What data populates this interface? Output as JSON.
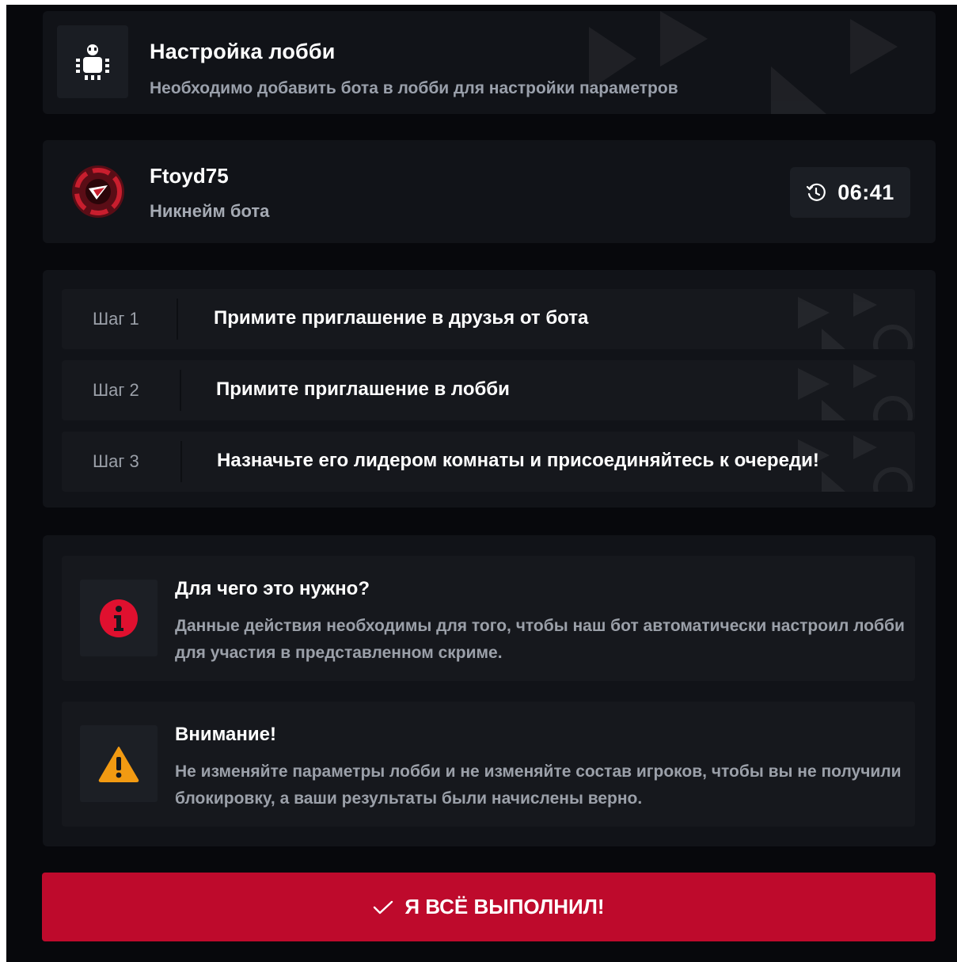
{
  "header": {
    "title": "Настройка лобби",
    "subtitle": "Необходимо добавить бота в лобби для настройки параметров",
    "icon": "robot-icon"
  },
  "bot": {
    "name": "Ftoyd75",
    "label": "Никнейм бота",
    "avatar_icon": "bot-avatar",
    "timer": "06:41",
    "timer_icon": "timer-icon"
  },
  "steps": [
    {
      "num": "Шаг 1",
      "text": "Примите приглашение в друзья от бота"
    },
    {
      "num": "Шаг 2",
      "text": "Примите приглашение в лобби"
    },
    {
      "num": "Шаг 3",
      "text": "Назначьте его лидером комнаты и присоединяйтесь к очереди!"
    }
  ],
  "notices": [
    {
      "icon": "info-icon",
      "title": "Для чего это нужно?",
      "text": "Данные действия необходимы для того, чтобы наш бот автоматически настроил лобби для участия в представленном скриме."
    },
    {
      "icon": "warning-icon",
      "title": "Внимание!",
      "text": "Не изменяйте параметры лобби и не изменяйте состав игроков, чтобы вы не получили блокировку, а ваши результаты были начислены верно."
    }
  ],
  "action": {
    "label": "Я ВСЁ ВЫПОЛНИЛ!",
    "icon": "check-icon"
  },
  "colors": {
    "background": "#07080c",
    "card": "#111318",
    "accent_red": "#be0a2c",
    "info_red": "#e0102f",
    "warning_orange": "#f29a12",
    "muted_text": "#9ba0a9"
  }
}
